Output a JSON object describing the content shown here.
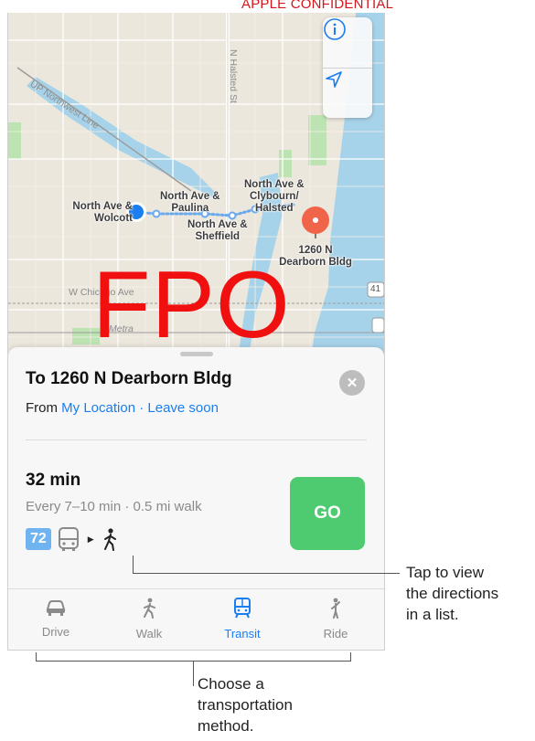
{
  "banner": "APPLE CONFIDENTIAL",
  "watermark": "FPO",
  "map": {
    "labels": {
      "origin": "North Ave &\nWolcott",
      "stop_paulina": "North Ave &\nPaulina",
      "stop_clybourn": "North Ave &\nClybourn/\nHalsted",
      "stop_sheffield": "North Ave &\nSheffield",
      "destination": "1260 N\nDearborn Bldg",
      "halsted": "N Halsted St",
      "chicago_ave": "W Chicago Ave",
      "up_northwest": "UP Northwest Line",
      "metra": "Metra",
      "shield": "41"
    },
    "controls": {
      "info_icon": "info-icon",
      "location_icon": "location-arrow-icon"
    },
    "colors": {
      "water": "#a7d3ea",
      "park": "#bde3b2",
      "route": "#6aa9ec",
      "pin": "#f0654a"
    }
  },
  "sheet": {
    "title": "To 1260 N Dearborn Bldg",
    "from_prefix": "From",
    "from_location": "My Location",
    "separator": "·",
    "leave_option": "Leave soon",
    "eta": "32 min",
    "frequency": "Every 7–10 min · 0.5 mi walk",
    "bus_number": "72",
    "go_label": "GO",
    "go_color": "#4ecb71"
  },
  "tabs": [
    {
      "label": "Drive",
      "icon": "car-icon",
      "active": false
    },
    {
      "label": "Walk",
      "icon": "walk-icon",
      "active": false
    },
    {
      "label": "Transit",
      "icon": "transit-icon",
      "active": true
    },
    {
      "label": "Ride",
      "icon": "ride-icon",
      "active": false
    }
  ],
  "annotations": {
    "walk_note": "Tap to view\nthe directions\nin a list.",
    "tabs_note": "Choose a\ntransportation\nmethod."
  }
}
